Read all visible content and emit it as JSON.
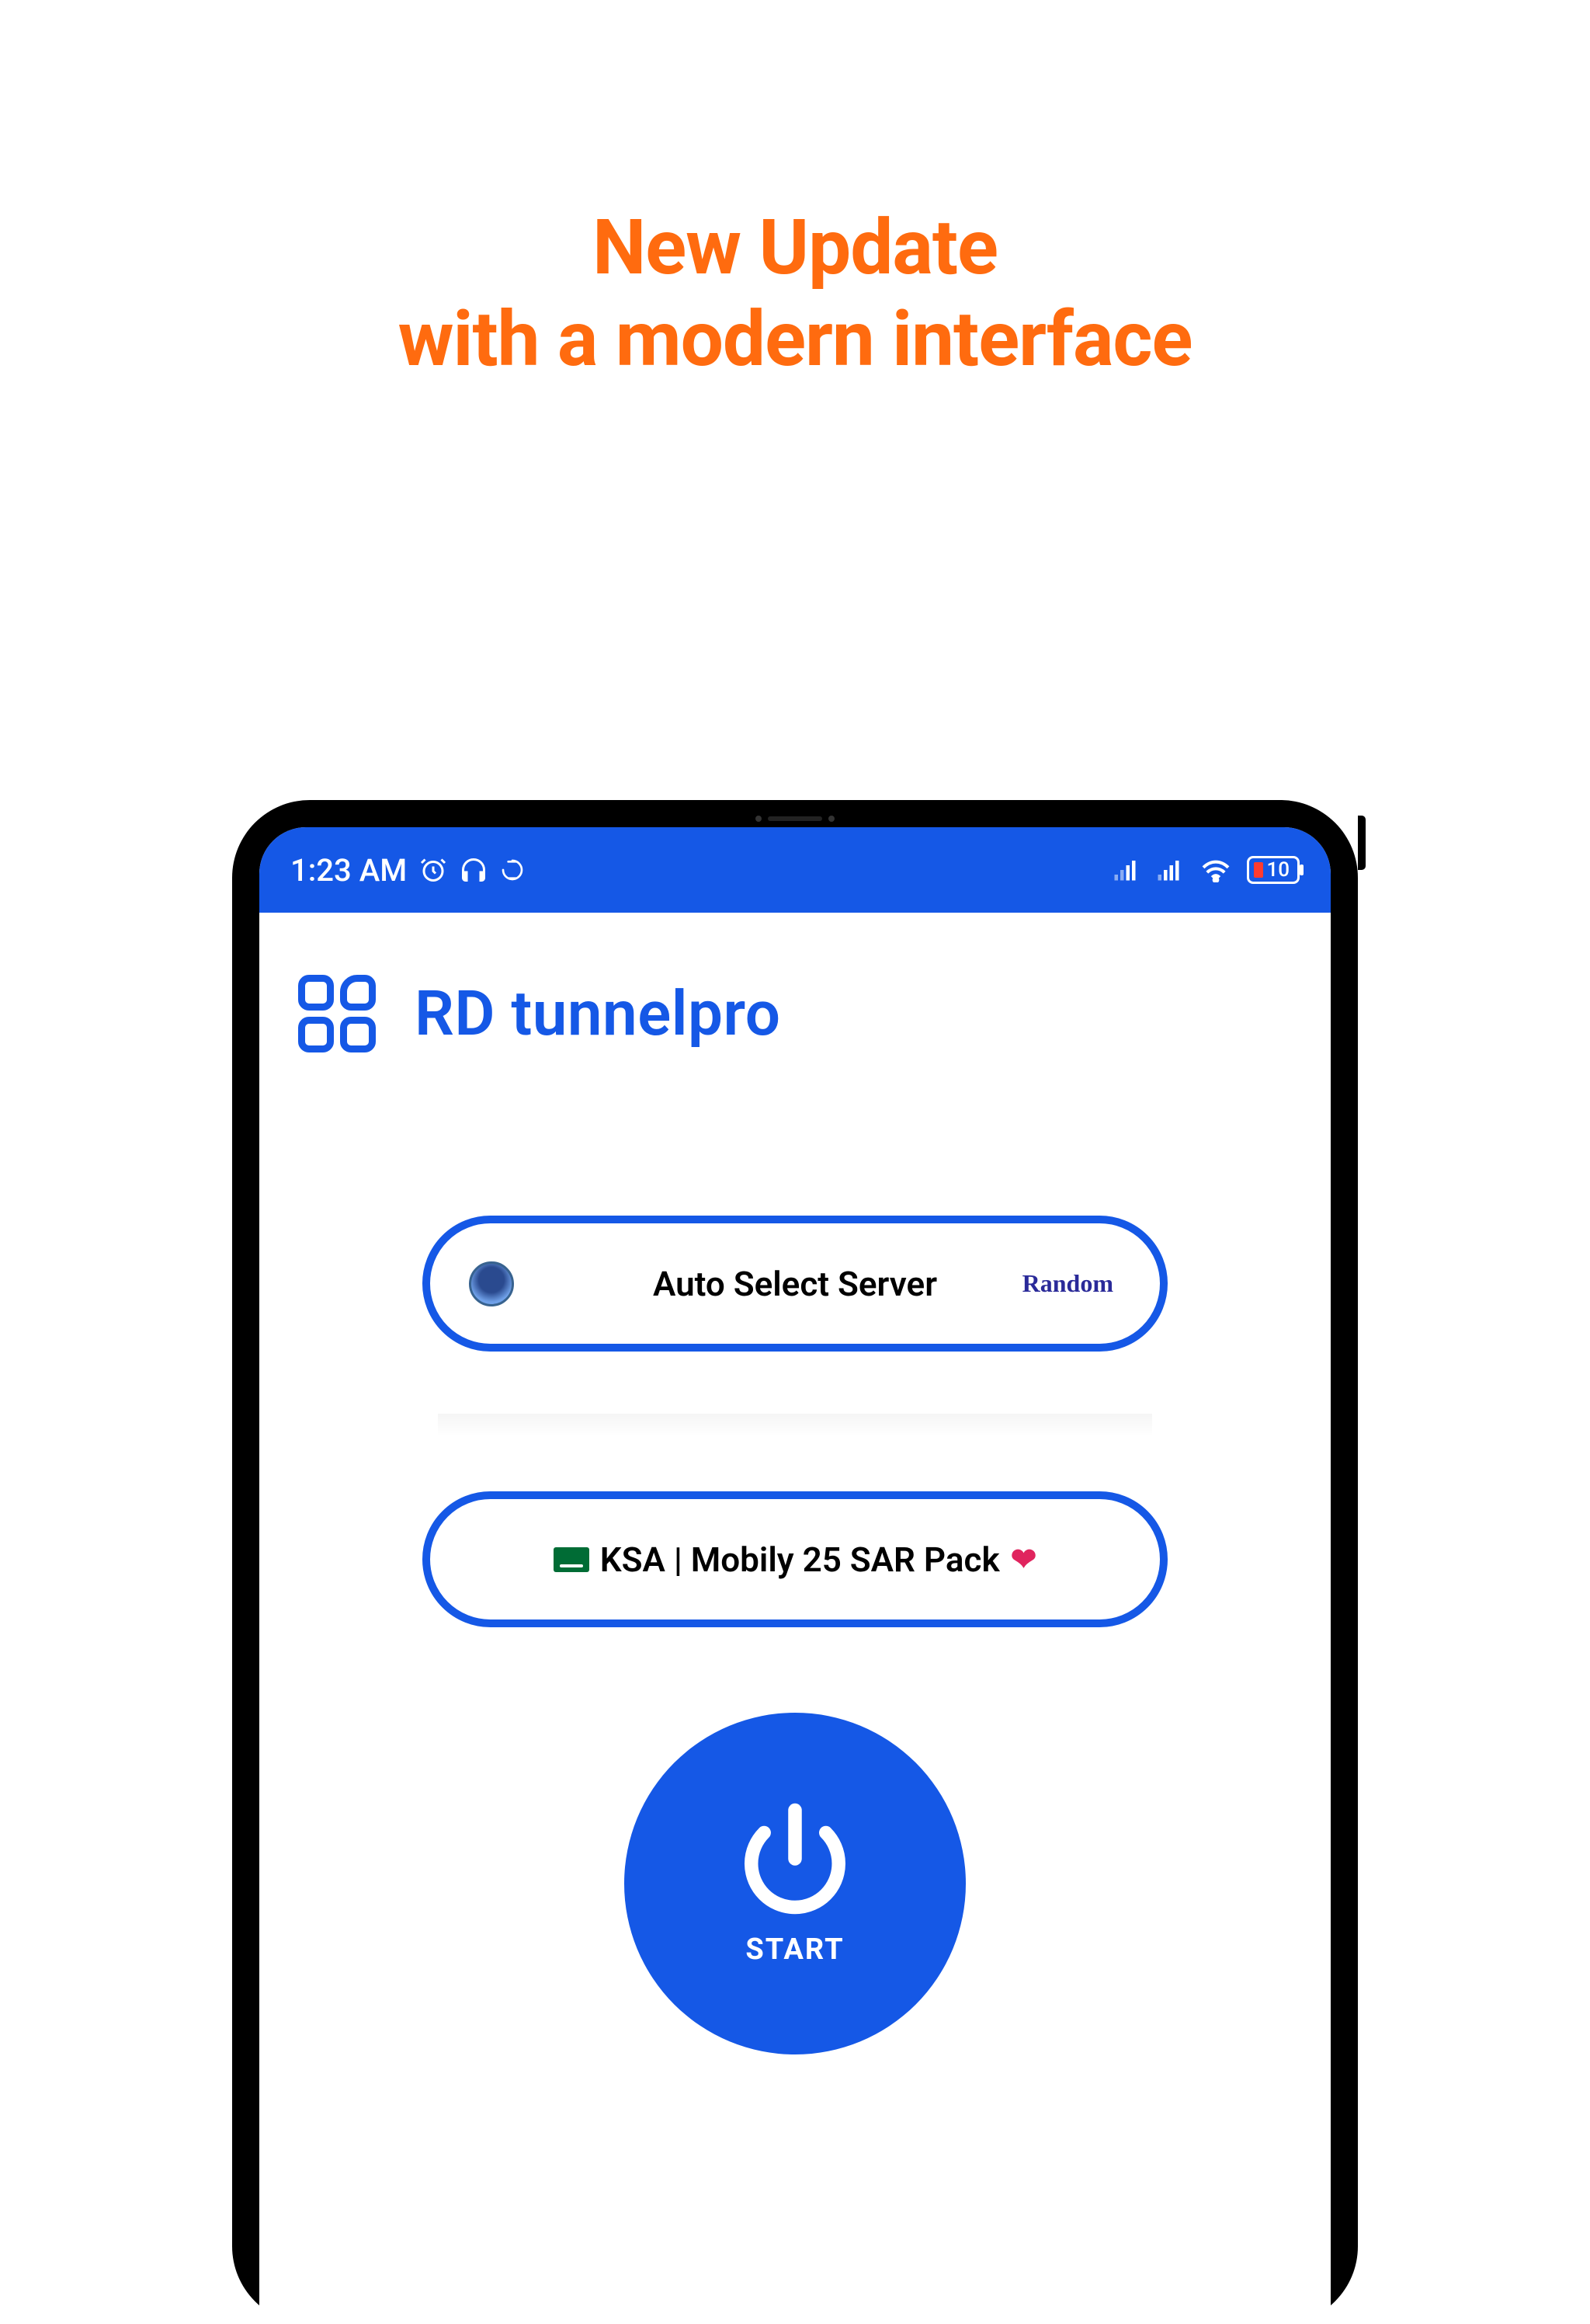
{
  "promo": {
    "line1": "New Update",
    "line2": "with a modern interface"
  },
  "status_bar": {
    "time": "1:23 AM",
    "battery_level": "10"
  },
  "app": {
    "title": "RD tunnelpro"
  },
  "server_selector": {
    "label": "Auto Select Server",
    "mode": "Random"
  },
  "pack_selector": {
    "label": "KSA | Mobily 25 SAR Pack"
  },
  "start_button": {
    "label": "START"
  }
}
